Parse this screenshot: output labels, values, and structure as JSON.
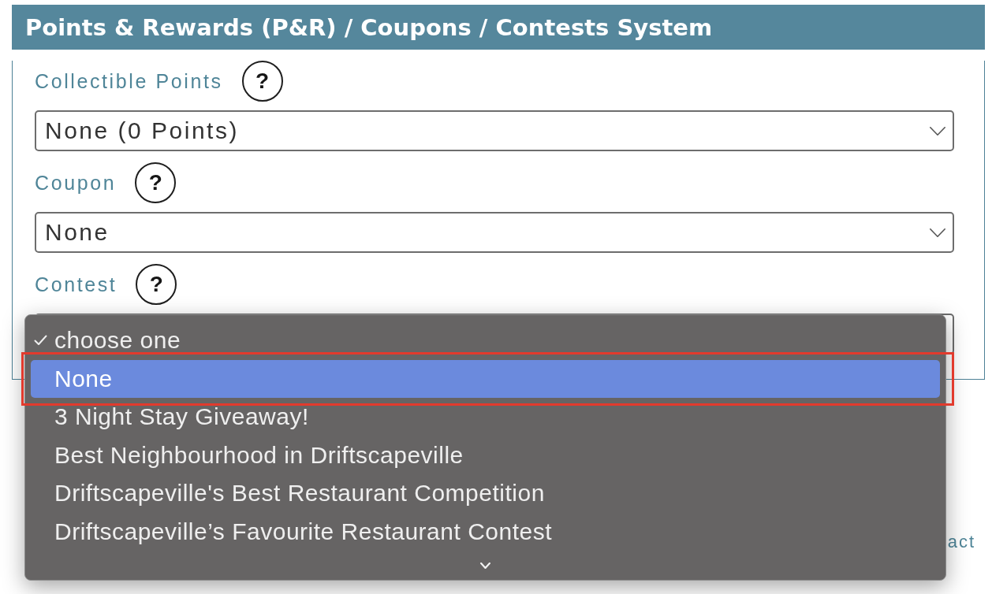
{
  "panel": {
    "title": "Points & Rewards (P&R) / Coupons / Contests System"
  },
  "fields": [
    {
      "label": "Collectible Points",
      "help": "?",
      "value": "None (0 Points)"
    },
    {
      "label": "Coupon",
      "help": "?",
      "value": "None"
    },
    {
      "label": "Contest",
      "help": "?",
      "menu": {
        "options": [
          {
            "label": "choose one",
            "selected": true,
            "highlighted": false,
            "outlined": false
          },
          {
            "label": "None",
            "selected": false,
            "highlighted": true,
            "outlined": true
          },
          {
            "label": "3 Night Stay Giveaway!",
            "selected": false,
            "highlighted": false,
            "outlined": false
          },
          {
            "label": "Best Neighbourhood in Driftscapeville",
            "selected": false,
            "highlighted": false,
            "outlined": false
          },
          {
            "label": "Driftscapeville's Best Restaurant Competition",
            "selected": false,
            "highlighted": false,
            "outlined": false
          },
          {
            "label": "Driftscapeville’s Favourite Restaurant Contest",
            "selected": false,
            "highlighted": false,
            "outlined": false
          }
        ]
      }
    }
  ],
  "footer": {
    "link": "act"
  }
}
